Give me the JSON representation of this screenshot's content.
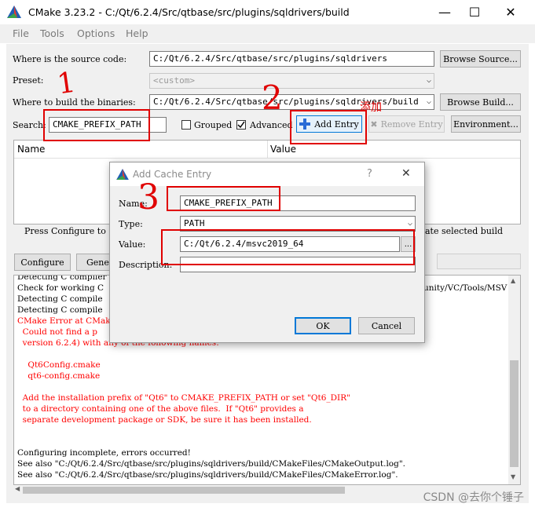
{
  "window": {
    "title": "CMake 3.23.2 - C:/Qt/6.2.4/Src/qtbase/src/plugins/sqldrivers/build",
    "minimize": "—",
    "maximize": "☐",
    "close": "✕"
  },
  "menu": [
    "File",
    "Tools",
    "Options",
    "Help"
  ],
  "source": {
    "label": "Where is the source code:",
    "value": "C:/Qt/6.2.4/Src/qtbase/src/plugins/sqldrivers",
    "browse": "Browse Source..."
  },
  "preset": {
    "label": "Preset:",
    "value": "<custom>"
  },
  "build": {
    "label": "Where to build the binaries:",
    "value": "C:/Qt/6.2.4/Src/qtbase/src/plugins/sqldrivers/build",
    "browse": "Browse Build..."
  },
  "search": {
    "label": "Search:",
    "value": "CMAKE_PREFIX_PATH",
    "grouped": "Grouped",
    "grouped_checked": false,
    "advanced": "Advanced",
    "advanced_checked": true,
    "add_entry": "Add Entry",
    "remove_entry": "Remove Entry",
    "environment": "Environment..."
  },
  "cache_table": {
    "columns": [
      "Name",
      "Value"
    ]
  },
  "hint": {
    "left": "Press Configure to",
    "right": "ate selected build"
  },
  "actions": {
    "configure": "Configure",
    "generate": "Gener"
  },
  "log": {
    "right_fragment": "unity/VC/Tools/MSV",
    "lines": [
      {
        "text": "Detecting C compiler",
        "color": "black"
      },
      {
        "text": "Check for working C",
        "color": "black"
      },
      {
        "text": "Detecting C compile",
        "color": "black"
      },
      {
        "text": "Detecting C compile",
        "color": "black"
      },
      {
        "text": "CMake Error at CMake",
        "color": "red"
      },
      {
        "text": "  Could not find a p",
        "color": "red"
      },
      {
        "text": "  version 6.2.4) with any of the following names:",
        "color": "red"
      },
      {
        "text": "",
        "color": "red"
      },
      {
        "text": "    Qt6Config.cmake",
        "color": "red"
      },
      {
        "text": "    qt6-config.cmake",
        "color": "red"
      },
      {
        "text": "",
        "color": "red"
      },
      {
        "text": "  Add the installation prefix of \"Qt6\" to CMAKE_PREFIX_PATH or set \"Qt6_DIR\"",
        "color": "red"
      },
      {
        "text": "  to a directory containing one of the above files.  If \"Qt6\" provides a",
        "color": "red"
      },
      {
        "text": "  separate development package or SDK, be sure it has been installed.",
        "color": "red"
      },
      {
        "text": "",
        "color": "red"
      },
      {
        "text": "",
        "color": "red"
      },
      {
        "text": "Configuring incomplete, errors occurred!",
        "color": "black"
      },
      {
        "text": "See also \"C:/Qt/6.2.4/Src/qtbase/src/plugins/sqldrivers/build/CMakeFiles/CMakeOutput.log\".",
        "color": "black"
      },
      {
        "text": "See also \"C:/Qt/6.2.4/Src/qtbase/src/plugins/sqldrivers/build/CMakeFiles/CMakeError.log\".",
        "color": "black"
      }
    ]
  },
  "dialog": {
    "title": "Add Cache Entry",
    "help": "?",
    "close": "✕",
    "name_label": "Name:",
    "name_value": "CMAKE_PREFIX_PATH",
    "type_label": "Type:",
    "type_value": "PATH",
    "value_label": "Value:",
    "value_value": "C:/Qt/6.2.4/msvc2019_64",
    "browse": "...",
    "description_label": "Description:",
    "description_value": "",
    "ok": "OK",
    "cancel": "Cancel"
  },
  "annotations": {
    "step1": "1",
    "step2": "2",
    "step3": "3",
    "add_note": "添加"
  },
  "watermark": "CSDN @去你个锤子",
  "colors": {
    "annotation_red": "#e00000",
    "error_text": "#ff0000",
    "panel_bg": "#f0f0f0"
  }
}
